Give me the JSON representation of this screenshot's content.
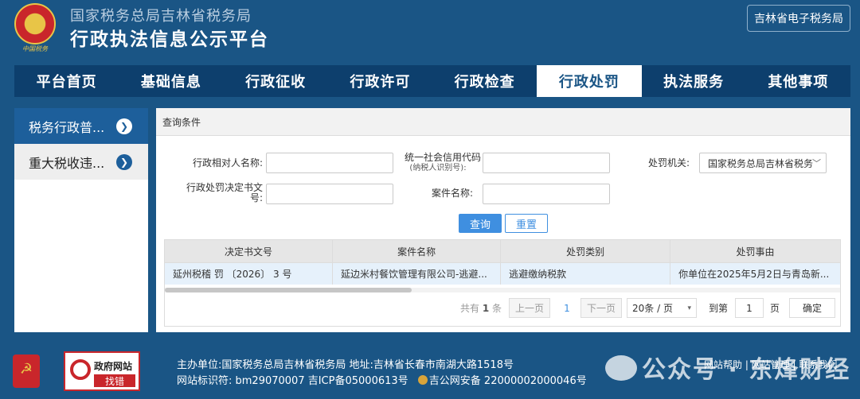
{
  "header": {
    "org_name": "国家税务总局吉林省税务局",
    "site_title": "行政执法信息公示平台",
    "emblem_caption": "中国税务",
    "etax_button": "吉林省电子税务局"
  },
  "nav": {
    "items": [
      "平台首页",
      "基础信息",
      "行政征收",
      "行政许可",
      "行政检查",
      "行政处罚",
      "执法服务",
      "其他事项"
    ],
    "active_index": 5
  },
  "sidebar": {
    "items": [
      {
        "label": "税务行政普..."
      },
      {
        "label": "重大税收违..."
      }
    ],
    "active_index": 0
  },
  "query": {
    "panel_title": "查询条件",
    "label_party_name": "行政相对人名称:",
    "label_credit_code": "统一社会信用代码",
    "label_credit_code_sub": "(纳税人识别号):",
    "label_authority": "处罚机关:",
    "authority_value": "国家税务总局吉林省税务",
    "label_decision_no_1": "行政处罚决定书文",
    "label_decision_no_2": "号:",
    "label_case_name": "案件名称:",
    "query_button": "查询",
    "reset_button": "重置"
  },
  "table": {
    "columns": [
      "决定书文号",
      "案件名称",
      "处罚类别",
      "处罚事由"
    ],
    "rows": [
      [
        "延州税稽 罚 〔2026〕 3 号",
        "延边米村餐饮管理有限公司-逃避...",
        "逃避缴纳税款",
        "你单位在2025年5月2日与青岛新..."
      ]
    ]
  },
  "pager": {
    "total_prefix": "共有",
    "total_count": "1",
    "total_suffix": "条",
    "prev": "上一页",
    "current_page": "1",
    "next": "下一页",
    "page_size": "20条 / 页",
    "goto_label": "到第",
    "goto_value": "1",
    "page_unit": "页",
    "confirm": "确定"
  },
  "footer": {
    "gov_box_title": "政府网站",
    "gov_box_sub": "找错",
    "host_line": "主办单位:国家税务总局吉林省税务局   地址:吉林省长春市南湖大路1518号",
    "id_line": "网站标识符: bm29070007 吉ICP备05000613号",
    "police_line": "吉公网安备 22000002000046号",
    "links": "网站帮助 | 网站管理 | 联系我们",
    "watermark": "公众号 · 东烽财经"
  },
  "colors": {
    "page_bg": "#1a5585",
    "nav_bg": "#0d3f6d",
    "accent_blue": "#3f8fe0",
    "sidebar_active": "#1d5f9b",
    "badge_red": "#c9262b"
  }
}
